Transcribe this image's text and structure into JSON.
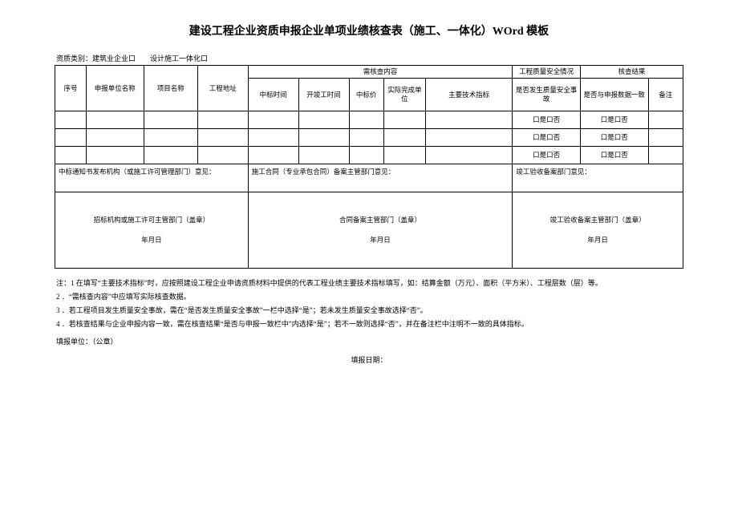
{
  "title": "建设工程企业资质申报企业单项业绩核查表（施工、一体化）WOrd 模板",
  "qual_type_label": "资质类别：建筑业企业口　　设计施工一体化口",
  "headers": {
    "seq": "序号",
    "report_unit": "申报单位名称",
    "project_name": "项目名称",
    "project_addr": "工程地址",
    "need_check": "需核查内容",
    "quality_safety": "工程质量安全情况",
    "check_result": "核查结果",
    "bid_time": "中标时间",
    "complete_time": "开竣工时间",
    "bid_price": "中标价",
    "actual_unit": "实际完成单位",
    "tech_index": "主要技术指标",
    "accident": "是否发生质量安全事故",
    "consistent": "是否与申报数据一致",
    "remark": "备注"
  },
  "cell_yesno": "口是口否",
  "signatures": {
    "left_label": "中标通知书发布机构（或施工许可管理部门）意见：",
    "mid_label": "施工合同（专业承包合同）备案主管部门意见：",
    "right_label": "竣工验收备案部门意见：",
    "left_stamp": "招标机构或施工许可主管部门（盖章）",
    "mid_stamp": "合同备案主管部门（盖章）",
    "right_stamp": "竣工验收备案主管部门（盖章）",
    "date": "年月日"
  },
  "notes": {
    "n1": "注：1 在填写“主要技术指标”时，应按照建设工程企业申请资质材料中提供的代表工程业绩主要技术指标填写，如：结算金额（万元）、面积（平方米）、工程层数（层）等。",
    "n2": "2 ．“需核查内容”中应填写实际核查数据。",
    "n3": "3 ．若工程项目发生质量安全事故，需在“是否发生质量安全事故”一栏中选择“是”；若未发生质量安全事故选择“否”。",
    "n4": "4 ．若核查结果与企业申报内容一致，需在核查结果“是否与申报一致栏中”内选择“是”；若不一致则选择“否”，并在备注栏中注明不一致的具体指标。"
  },
  "fill_unit": "填报单位：（公章）",
  "fill_date": "填报日期："
}
